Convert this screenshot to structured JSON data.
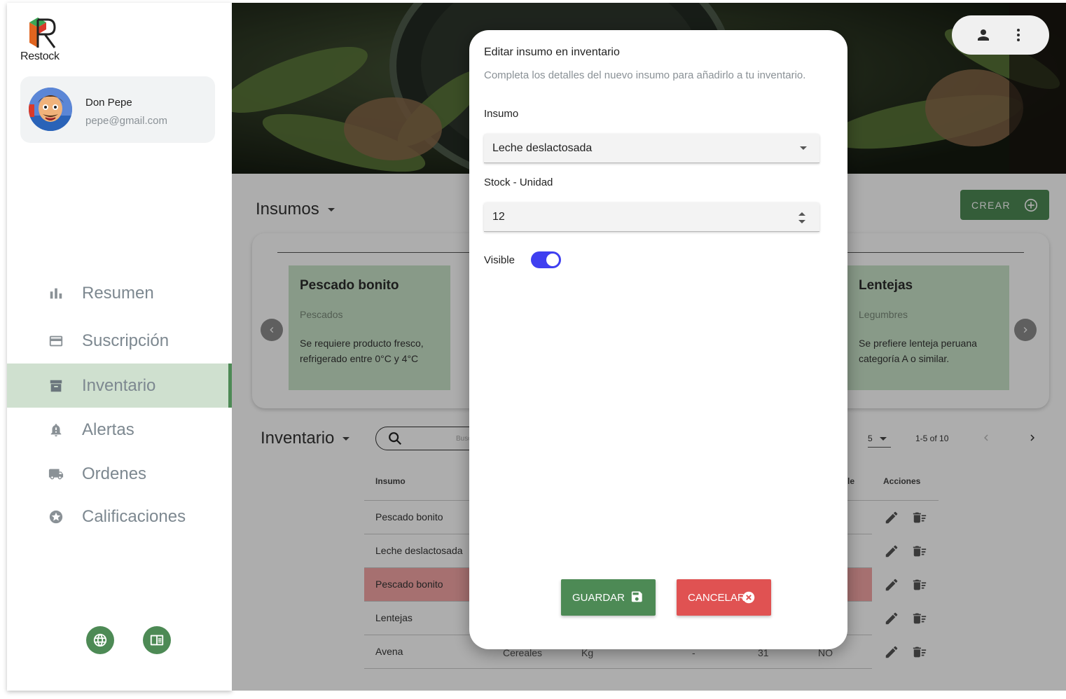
{
  "brand": {
    "name": "Restock"
  },
  "profile": {
    "name": "Don Pepe",
    "email": "pepe@gmail.com"
  },
  "nav": {
    "items": [
      {
        "label": "Resumen",
        "icon": "bar-chart-icon"
      },
      {
        "label": "Suscripción",
        "icon": "credit-card-icon"
      },
      {
        "label": "Inventario",
        "icon": "archive-icon",
        "active": true
      },
      {
        "label": "Alertas",
        "icon": "bell-icon"
      },
      {
        "label": "Ordenes",
        "icon": "truck-icon"
      },
      {
        "label": "Calificaciones",
        "icon": "star-icon"
      }
    ]
  },
  "footer_buttons": {
    "left_icon": "globe-icon",
    "right_icon": "book-icon"
  },
  "main": {
    "insumos_title": "Insumos",
    "crear_label": "CREAR",
    "cards": [
      {
        "title": "Pescado bonito",
        "category": "Pescados",
        "description": "Se requiere producto fresco, refrigerado entre 0°C y 4°C"
      },
      {
        "title": "Lentejas",
        "category": "Legumbres",
        "description": "Se prefiere lenteja peruana categoría A o similar."
      }
    ],
    "inventario_title": "Inventario",
    "search_placeholder": "Busc",
    "pager": {
      "per_page": "5",
      "range": "1-5 of 10"
    },
    "table": {
      "headers": {
        "insumo": "Insumo",
        "visible_partial": "le",
        "acciones": "Acciones"
      },
      "rows": [
        {
          "insumo": "Pescado bonito",
          "highlight": false
        },
        {
          "insumo": "Leche deslactosada",
          "highlight": false
        },
        {
          "insumo": "Pescado bonito",
          "highlight": true
        },
        {
          "insumo": "Lentejas",
          "highlight": false
        },
        {
          "insumo": "Avena",
          "highlight": false,
          "partial": [
            "Cereales",
            "Kg",
            "-",
            "31",
            "NO"
          ]
        }
      ]
    }
  },
  "modal": {
    "title": "Editar insumo en inventario",
    "description": "Completa los detalles del nuevo insumo para añadirlo a tu inventario.",
    "insumo_label": "Insumo",
    "insumo_value": "Leche deslactosada",
    "stock_label": "Stock - Unidad",
    "stock_value": "12",
    "visible_label": "Visible",
    "visible_on": true,
    "save_label": "GUARDAR",
    "cancel_label": "CANCELAR"
  },
  "colors": {
    "primary": "#4d8a55",
    "danger": "#e05252",
    "toggle": "#3f3ff0",
    "highlight": "#f5a6a6",
    "card": "#c9e3c9"
  }
}
